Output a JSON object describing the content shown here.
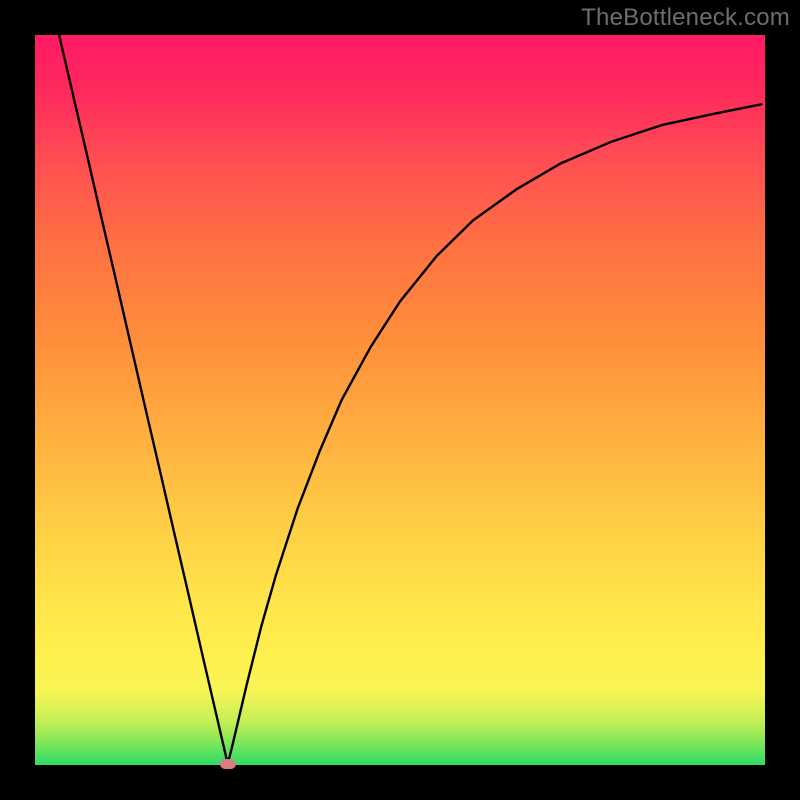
{
  "watermark_text": "TheBottleneck.com",
  "colors": {
    "frame": "#000000",
    "curve": "#000000",
    "marker": "#d97d84",
    "watermark": "#6d6d6d"
  },
  "chart_data": {
    "type": "line",
    "title": "",
    "xlabel": "",
    "ylabel": "",
    "xlim": [
      0,
      1
    ],
    "ylim": [
      0,
      1
    ],
    "axes_visible": false,
    "grid": false,
    "background": "vertical-gradient green→yellow→red",
    "series": [
      {
        "name": "bottleneck-curve",
        "color": "#000000",
        "x": [
          0.033,
          0.05,
          0.07,
          0.09,
          0.11,
          0.13,
          0.15,
          0.17,
          0.19,
          0.21,
          0.23,
          0.25,
          0.264,
          0.27,
          0.29,
          0.31,
          0.33,
          0.36,
          0.39,
          0.42,
          0.46,
          0.5,
          0.55,
          0.6,
          0.66,
          0.72,
          0.79,
          0.86,
          0.93,
          0.995
        ],
        "y": [
          1.0,
          0.927,
          0.841,
          0.754,
          0.668,
          0.581,
          0.494,
          0.408,
          0.321,
          0.235,
          0.148,
          0.062,
          0.0014,
          0.025,
          0.11,
          0.19,
          0.26,
          0.352,
          0.43,
          0.5,
          0.573,
          0.635,
          0.697,
          0.746,
          0.789,
          0.824,
          0.854,
          0.877,
          0.892,
          0.905
        ]
      }
    ],
    "annotations": [
      {
        "type": "marker",
        "x": 0.264,
        "y": 0.0014,
        "label": "minimum"
      }
    ]
  }
}
